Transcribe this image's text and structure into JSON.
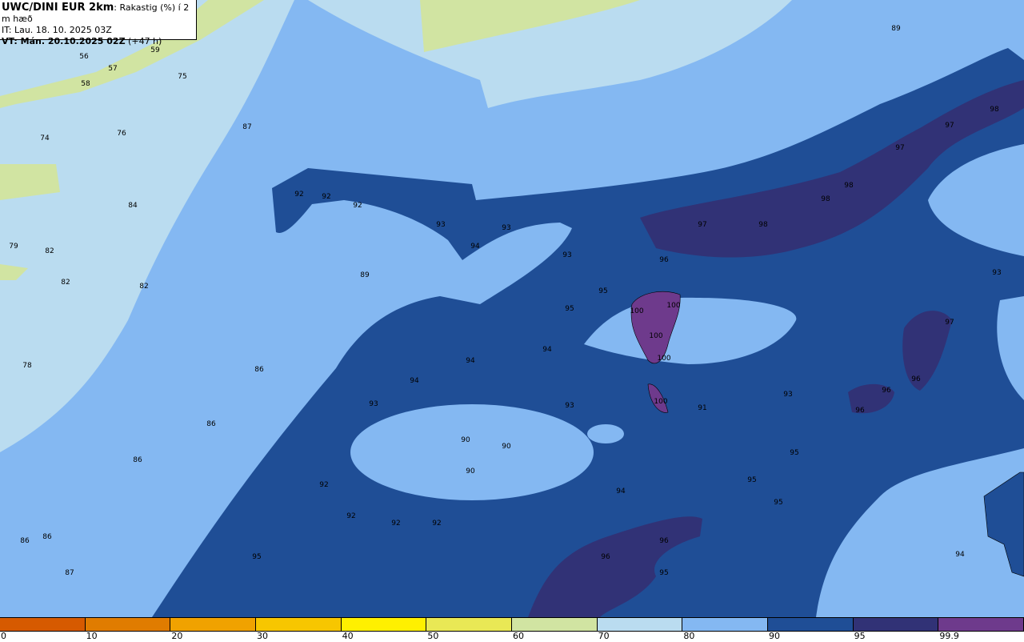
{
  "header": {
    "model": "UWC/DINI EUR 2km",
    "parameter": ": Rakastig (%) í 2 m hæð",
    "issue_time": "IT: Lau. 18. 10. 2025 03Z",
    "valid_time": "VT: Mán. 20.10.2025 02Z",
    "lead": " (+47 h)"
  },
  "colorbar": {
    "ticks": [
      "0",
      "10",
      "20",
      "30",
      "40",
      "50",
      "60",
      "70",
      "80",
      "90",
      "95",
      "99.9"
    ],
    "colors": [
      "#d65a00",
      "#e07c00",
      "#f0a200",
      "#f7c600",
      "#fff000",
      "#e9e855",
      "#d1e4a2",
      "#badcf0",
      "#84b8f2",
      "#1f4e96",
      "#313276",
      "#6e3a8c"
    ]
  },
  "map": {
    "value_labels": [
      "89",
      "59",
      "56",
      "57",
      "58",
      "75",
      "98",
      "97",
      "97",
      "87",
      "74",
      "76",
      "98",
      "98",
      "92",
      "92",
      "92",
      "84",
      "93",
      "93",
      "97",
      "98",
      "94",
      "93",
      "96",
      "79",
      "82",
      "82",
      "82",
      "89",
      "93",
      "95",
      "95",
      "100",
      "100",
      "97",
      "100",
      "94",
      "94",
      "100",
      "78",
      "86",
      "94",
      "96",
      "96",
      "93",
      "93",
      "93",
      "100",
      "91",
      "96",
      "86",
      "90",
      "90",
      "90",
      "95",
      "86",
      "95",
      "92",
      "94",
      "95",
      "92",
      "92",
      "92",
      "86",
      "86",
      "96",
      "95",
      "96",
      "94",
      "87",
      "95"
    ]
  }
}
